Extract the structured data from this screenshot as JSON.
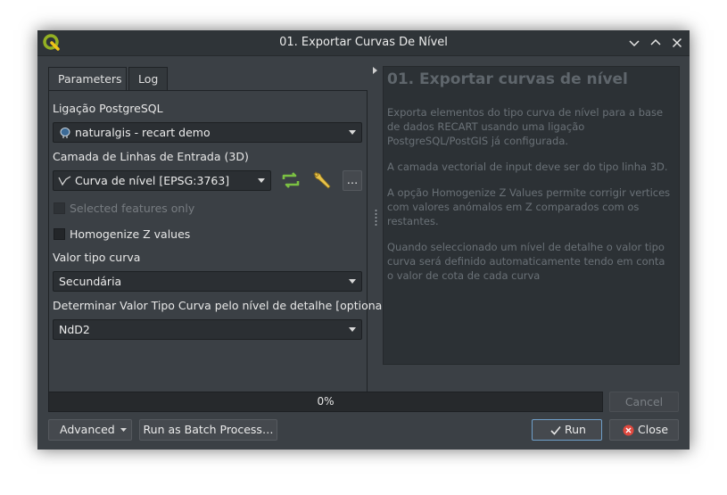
{
  "window": {
    "title": "01. Exportar Curvas De Nível"
  },
  "tabs": [
    {
      "label": "Parameters"
    },
    {
      "label": "Log"
    }
  ],
  "params": {
    "conn_label": "Ligação PostgreSQL",
    "conn_value": "naturalgis - recart demo",
    "layer_label": "Camada de Linhas de Entrada (3D)",
    "layer_value": "Curva de nível [EPSG:3763]",
    "ellipsis": "…",
    "selected_only": "Selected features only",
    "homogenize": "Homogenize Z values",
    "tipo_label": "Valor tipo curva",
    "tipo_value": "Secundária",
    "detalhe_label": "Determinar Valor Tipo Curva pelo nível de detalhe [optional]",
    "detalhe_value": "NdD2"
  },
  "help": {
    "title": "01. Exportar curvas de nível",
    "paragraphs": [
      "Exporta elementos do tipo curva de nível para a base de dados RECART usando uma ligação PostgreSQL/PostGIS já configurada.",
      "A camada vectorial de input deve ser do tipo linha 3D.",
      "A opção Homogenize Z Values permite corrigir vertices com valores anómalos em Z comparados com os restantes.",
      "Quando seleccionado um nível de detalhe o valor tipo curva será definido automaticamente tendo em conta o valor de cota de cada curva"
    ]
  },
  "progress": {
    "text": "0%",
    "value": 0
  },
  "buttons": {
    "cancel": "Cancel",
    "advanced": "Advanced",
    "batch": "Run as Batch Process…",
    "run": "Run",
    "close": "Close"
  },
  "colors": {
    "accent_blue": "#6f9fc9",
    "green_icon": "#7bc043",
    "close_red": "#e0493f"
  },
  "icons": [
    "qgis-logo-icon",
    "minimize-icon",
    "maximize-icon",
    "close-icon",
    "postgres-icon",
    "line-layer-icon",
    "iterate-icon",
    "wrench-icon",
    "checkmark-icon",
    "close-circle-icon"
  ]
}
